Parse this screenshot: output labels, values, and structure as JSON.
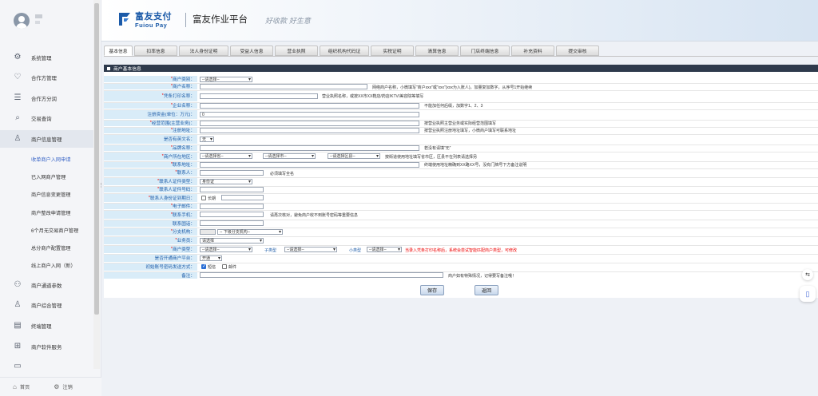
{
  "header": {
    "logo_cn": "富友支付",
    "logo_en": "Fuiou Pay",
    "title": "富友作业平台",
    "slogan": "好收款 好生意"
  },
  "sidebar": {
    "items": [
      {
        "label": "系统管理",
        "icon": "gear-icon"
      },
      {
        "label": "合作方管理",
        "icon": "handshake-icon"
      },
      {
        "label": "合作方分润",
        "icon": "database-icon"
      },
      {
        "label": "交易查询",
        "icon": "search-icon"
      },
      {
        "label": "商户信息管理",
        "icon": "user-manage-icon"
      },
      {
        "label": "商户通道参数",
        "icon": "channel-icon"
      },
      {
        "label": "商户综合管理",
        "icon": "users-icon"
      },
      {
        "label": "终端管理",
        "icon": "terminal-icon"
      },
      {
        "label": "商户软件服务",
        "icon": "grid-icon"
      },
      {
        "label": "",
        "icon": "more-icon"
      }
    ],
    "subitems": [
      "收单商户入网申请",
      "已入网商户管理",
      "商户信息变更管理",
      "商户整改申请管理",
      "6个月无交易商户管理",
      "总分商户配置管理",
      "线上商户入网（新）"
    ],
    "bottom": {
      "home_label": "首页",
      "logout_label": "注销"
    }
  },
  "tabs": [
    "基本信息",
    "扣率信息",
    "法人身份证明",
    "受益人信息",
    "营业执照",
    "组织机构代码证",
    "实税证明",
    "清算信息",
    "门店终端信息",
    "补充资料",
    "提交审核"
  ],
  "form": {
    "section_title": "商户基本信息",
    "rows": [
      {
        "label": "商户类别：",
        "required": true
      },
      {
        "label": "商户名称：",
        "required": true
      },
      {
        "label": "凭条打印名称：",
        "required": true
      },
      {
        "label": "企业名称：",
        "required": true
      },
      {
        "label": "注册资金(单位：万元)：",
        "required": false
      },
      {
        "label": "经营范围(主营业务)：",
        "required": true
      },
      {
        "label": "注册地址：",
        "required": true
      },
      {
        "label": "是否有英文名：",
        "required": false
      },
      {
        "label": "品牌名称：",
        "required": true
      },
      {
        "label": "商户所在地区：",
        "required": true
      },
      {
        "label": "联系地址：",
        "required": true
      },
      {
        "label": "联系人：",
        "required": true
      },
      {
        "label": "联系人证件类型：",
        "required": true
      },
      {
        "label": "联系人证件号码：",
        "required": true
      },
      {
        "label": "联系人身份证到期日：",
        "required": true
      },
      {
        "label": "电子邮件：",
        "required": true
      },
      {
        "label": "联系手机：",
        "required": true
      },
      {
        "label": "联系固话：",
        "required": false
      },
      {
        "label": "分支机构：",
        "required": true
      },
      {
        "label": "业务员：",
        "required": true
      },
      {
        "label": "商户类型：",
        "required": true
      },
      {
        "label": "是否开通商户平台：",
        "required": false
      },
      {
        "label": "初始账号密码发送方式：",
        "required": false
      },
      {
        "label": "备注：",
        "required": false
      }
    ],
    "values": {
      "merchant_type_select": "--请选择--",
      "reg_capital": "0",
      "english_name_select": "无",
      "province_select": "--请选择省--",
      "city_select": "--请选择市--",
      "district_select": "--请选择区县--",
      "id_type_select": "身份证",
      "long_term_label": "长期",
      "branch_select": "-- 下级分支机构-- ",
      "salesman_select": "请选择",
      "mch_type_select": "--请选择--",
      "sub_type_label": "子类型",
      "sub_type_select": "--请选择--",
      "small_type_label": "小类型",
      "small_type_select": "--请选择--",
      "platform_select": "开通",
      "send_sms_label": "短信",
      "send_email_label": "邮件"
    },
    "notes": {
      "merchant_name": "网络商户名称，小微填写“商户xxx”或“xxx”(xxx为入账人)，加量复加数字，从序号1开始继续",
      "receipt_name": "营业执照名称，或按XX市XX鞋店/药店/KTV/美容院等填写",
      "company_name": "不能加任何后缀，加数字1、2、3",
      "business_scope": "按营业执照主营业务或实际经营范围填写",
      "reg_address": "按营业执照注册地址填写，小微商户填写可联系地址",
      "brand": "若没有请填“无”",
      "region": "按街道使用地址填写省市区，区县不在列表请选择另",
      "contact_address": "终端使用地址精确到XX路XX号，没有门牌号下方备注说明",
      "contact_person": "必须填写全名",
      "mobile": "请再次核对，避免商户收不到账号密码等重要信息",
      "mch_type": "当录入凭条打印名称后，系统会尝试智能匹配商户类型，可修改",
      "remark": "商户如有特殊情况，记得要写备注哦！"
    },
    "buttons": {
      "save": "保存",
      "back": "返回"
    }
  }
}
